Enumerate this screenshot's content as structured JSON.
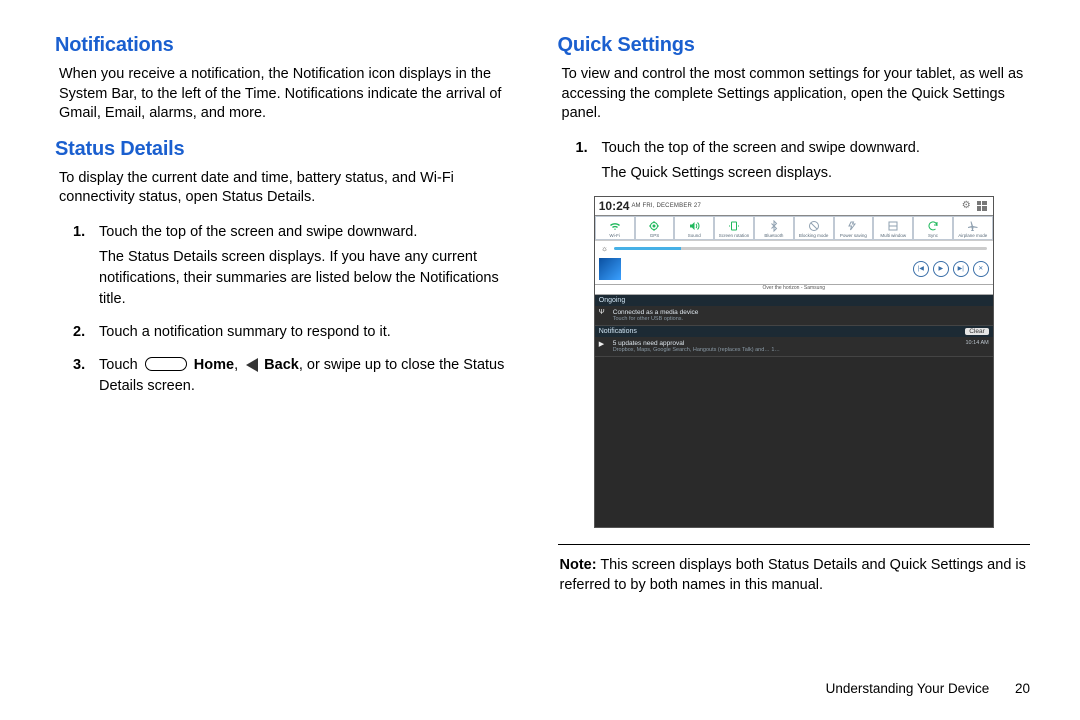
{
  "left": {
    "h_notifications": "Notifications",
    "p_notifications": "When you receive a notification, the Notification icon displays in the System Bar, to the left of the Time. Notifications indicate the arrival of Gmail, Email, alarms, and more.",
    "h_status": "Status Details",
    "p_status": "To display the current date and time, battery status, and Wi-Fi connectivity status, open Status Details.",
    "steps": {
      "n1": "1.",
      "s1a": "Touch the top of the screen and swipe downward.",
      "s1b": "The Status Details screen displays. If you have any current notifications, their summaries are listed below the Notifications title.",
      "n2": "2.",
      "s2": "Touch a notification summary to respond to it.",
      "n3": "3.",
      "s3_pre": "Touch ",
      "s3_home": " Home",
      "s3_mid": ", ",
      "s3_back": " Back",
      "s3_post": ", or swipe up to close the Status Details screen."
    }
  },
  "right": {
    "h_quick": "Quick Settings",
    "p_quick": "To view and control the most common settings for your tablet, as well as accessing the complete Settings application, open the Quick Settings panel.",
    "n1": "1.",
    "s1a": "Touch the top of the screen and swipe downward.",
    "s1b": "The Quick Settings screen displays.",
    "note_label": "Note:",
    "note_body": " This screen displays both Status Details and Quick Settings and is referred to by both names in this manual."
  },
  "shot": {
    "time": "10:24",
    "ampm": "AM",
    "date": "FRI, DECEMBER 27",
    "tiles": [
      {
        "glyph": "▶",
        "label": "Wi-Fi",
        "cls": "t-on",
        "svg": "wifi"
      },
      {
        "glyph": "◎",
        "label": "GPS",
        "cls": "t-on",
        "svg": "gps"
      },
      {
        "glyph": "◀",
        "label": "Sound",
        "cls": "t-on",
        "svg": "sound"
      },
      {
        "glyph": "↻",
        "label": "Screen rotation",
        "cls": "t-on",
        "svg": "rot"
      },
      {
        "glyph": "$",
        "label": "Bluetooth",
        "cls": "t-off",
        "svg": "bt"
      },
      {
        "glyph": "⊘",
        "label": "Blocking mode",
        "cls": "t-off",
        "svg": "block"
      },
      {
        "glyph": "♻",
        "label": "Power saving",
        "cls": "t-off",
        "svg": "power"
      },
      {
        "glyph": "▤",
        "label": "Multi window",
        "cls": "t-off",
        "svg": "multi"
      },
      {
        "glyph": "⟳",
        "label": "Sync",
        "cls": "t-on",
        "svg": "sync"
      },
      {
        "glyph": "✈",
        "label": "Airplane mode",
        "cls": "t-off",
        "svg": "air"
      }
    ],
    "track_caption": "Over the horizon - Samsung",
    "ongoing": "Ongoing",
    "media_title": "Connected as a media device",
    "media_sub": "Touch for other USB options.",
    "notif_hdr": "Notifications",
    "clear": "Clear",
    "upd_title": "5 updates need approval",
    "upd_sub": "Dropbox, Maps, Google Search, Hangouts (replaces Talk) and… 1…",
    "upd_time": "10:14 AM"
  },
  "footer": {
    "section": "Understanding Your Device",
    "page": "20"
  }
}
